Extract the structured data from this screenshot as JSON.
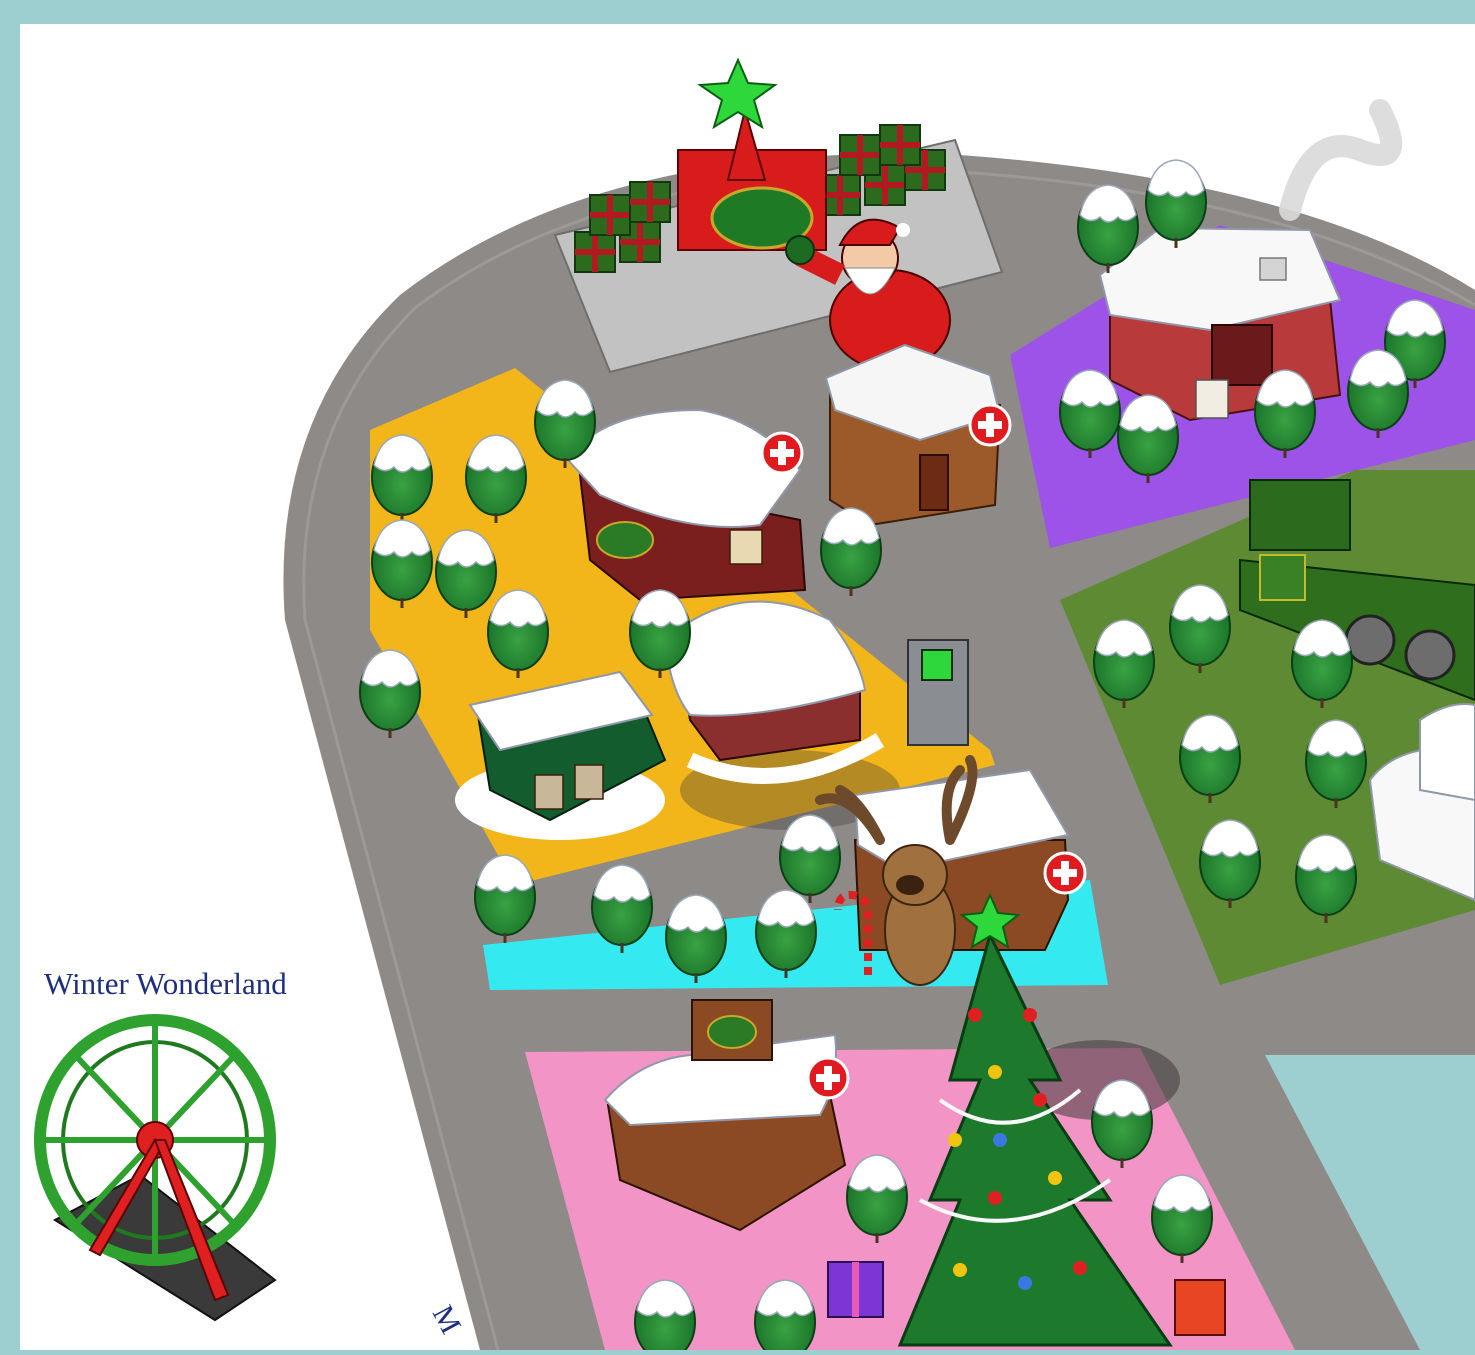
{
  "map": {
    "region_label": "Winter Wonderland",
    "road_label": "M",
    "first_aid_symbol": "+",
    "colors": {
      "frame": "#9ecfd0",
      "background": "#ffffff",
      "road": "#8e8a88",
      "zone_orange": "#f2b51a",
      "zone_purple": "#9d52e8",
      "zone_green": "#5f8a34",
      "zone_cyan": "#34eaf0",
      "zone_pink": "#f394c6",
      "zone_teal": "#9ecfd0",
      "first_aid": "#e01b20"
    },
    "icons": [
      "star-topper-icon",
      "santa-icon",
      "gift-pile-icon",
      "snow-tree-icon",
      "cabin-icon",
      "gingerbread-house-icon",
      "brick-house-chimney-icon",
      "train-locomotive-icon",
      "atm-kiosk-icon",
      "reindeer-icon",
      "candy-cane-icon",
      "christmas-tree-icon",
      "ferris-wheel-icon",
      "first-aid-icon"
    ]
  }
}
